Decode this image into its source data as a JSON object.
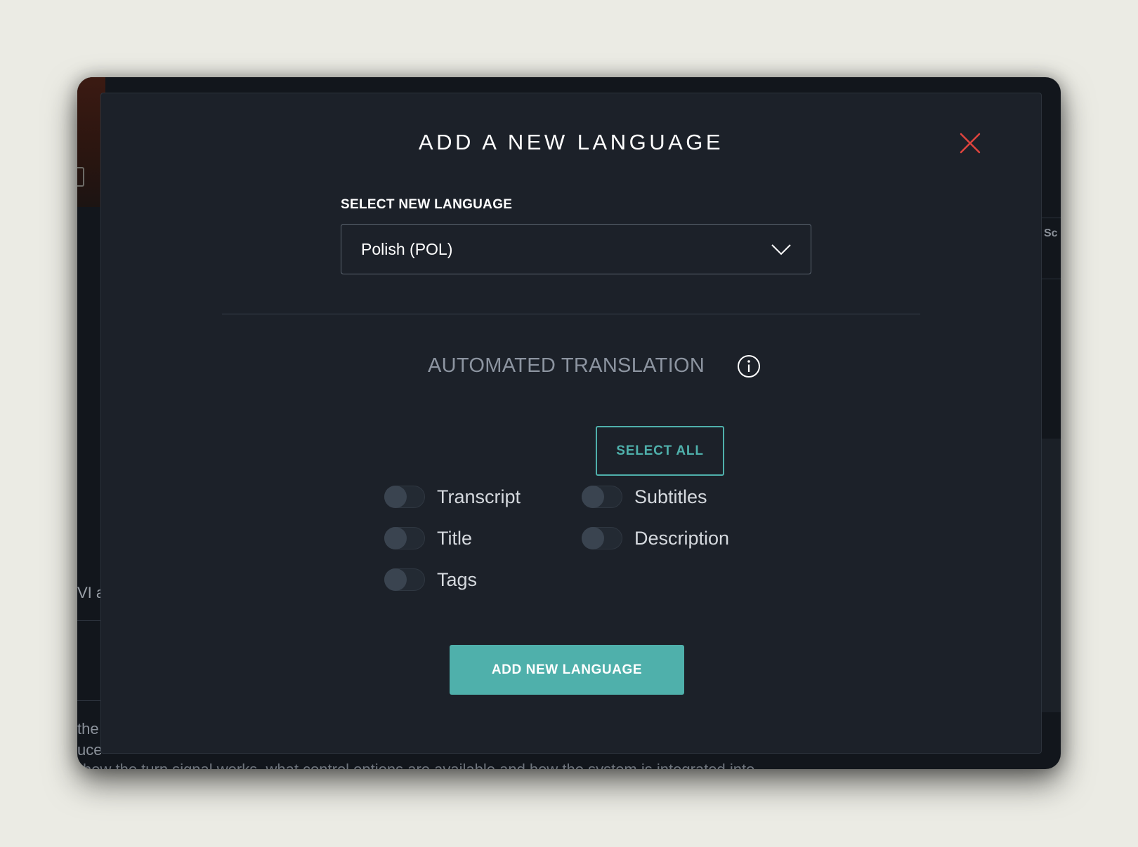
{
  "modal": {
    "title": "ADD A NEW LANGUAGE",
    "select_label": "SELECT NEW LANGUAGE",
    "selected_language": "Polish (POL)",
    "section_title": "AUTOMATED TRANSLATION",
    "select_all_label": "SELECT ALL",
    "toggles": {
      "transcript": {
        "label": "Transcript",
        "on": false
      },
      "subtitles": {
        "label": "Subtitles",
        "on": false
      },
      "title": {
        "label": "Title",
        "on": false
      },
      "description": {
        "label": "Description",
        "on": false
      },
      "tags": {
        "label": "Tags",
        "on": false
      }
    },
    "submit_label": "ADD NEW LANGUAGE"
  },
  "background": {
    "right_label": "Sc",
    "left_text": "VI a",
    "bottom_lines": [
      "the",
      "uce"
    ],
    "bottom_sentence": "how the turn signal works, what control options are available and how the system is integrated into"
  },
  "colors": {
    "accent": "#4fb0ab",
    "close": "#e0443e",
    "modal_bg": "#1c2129"
  },
  "icons": {
    "close": "close-icon",
    "dropdown": "chevron-down-icon",
    "info": "info-icon"
  }
}
